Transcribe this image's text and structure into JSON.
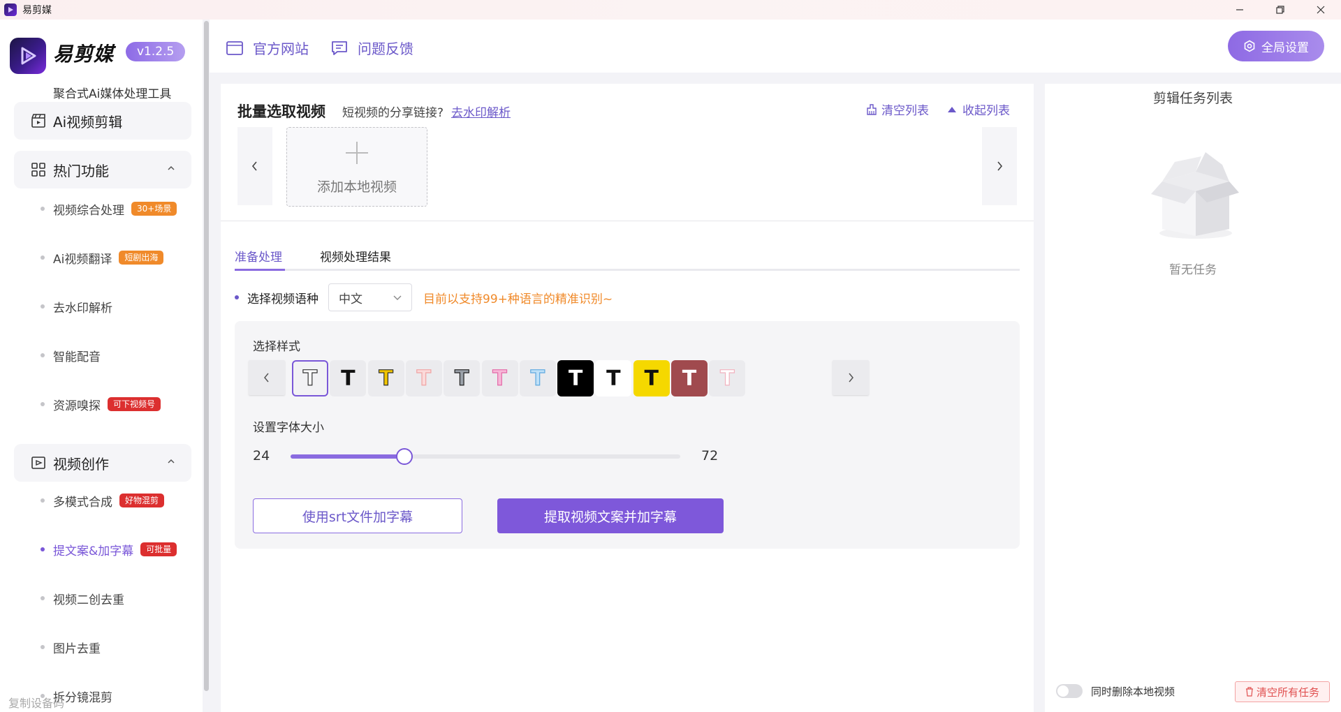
{
  "window": {
    "title": "易剪媒",
    "minimize": "—",
    "restore": "❐",
    "close": "✕"
  },
  "brand": {
    "name": "易剪媒",
    "version": "v1.2.5",
    "subtitle": "聚合式Ai媒体处理工具"
  },
  "sidebar": {
    "ai_edit": "Ai视频剪辑",
    "hot_group": "热门功能",
    "hot_items": [
      {
        "label": "视频综合处理",
        "badge": "30+场景",
        "badge_color": "#f08a2a"
      },
      {
        "label": "Ai视频翻译",
        "badge": "短剧出海",
        "badge_color": "#f08a2a"
      },
      {
        "label": "去水印解析",
        "badge": ""
      },
      {
        "label": "智能配音",
        "badge": ""
      },
      {
        "label": "资源嗅探",
        "badge": "可下视频号",
        "badge_color": "#dc2f2f"
      }
    ],
    "create_group": "视频创作",
    "create_items": [
      {
        "label": "多模式合成",
        "badge": "好物混剪",
        "badge_color": "#dc2f2f"
      },
      {
        "label": "提文案&加字幕",
        "badge": "可批量",
        "badge_color": "#dc2f2f",
        "active": true
      },
      {
        "label": "视频二创去重",
        "badge": ""
      },
      {
        "label": "图片去重",
        "badge": ""
      },
      {
        "label": "拆分镜混剪",
        "badge": ""
      }
    ],
    "copy_device": "复制设备码"
  },
  "topbar": {
    "official_site": "官方网站",
    "feedback": "问题反馈",
    "global_settings": "全局设置"
  },
  "batch": {
    "title": "批量选取视频",
    "share_prompt": "短视频的分享链接?",
    "share_link": "去水印解析",
    "clear_list": "清空列表",
    "collapse_list": "收起列表",
    "add_local": "添加本地视频"
  },
  "tabs": {
    "prepare": "准备处理",
    "results": "视频处理结果"
  },
  "language": {
    "label": "选择视频语种",
    "selected": "中文",
    "note": "目前以支持99+种语言的精准识别~"
  },
  "style": {
    "label": "选择样式",
    "chip_glyph": "T",
    "chips": [
      {
        "name": "outline-white",
        "bg": "#f2f2f4",
        "fg": "#ffffff",
        "stroke": "#333333",
        "selected": true
      },
      {
        "name": "plain-black",
        "bg": "#ebebee",
        "fg": "#111111",
        "stroke": ""
      },
      {
        "name": "yellow-outline",
        "bg": "#ebebee",
        "fg": "#f0c400",
        "stroke": "#333333"
      },
      {
        "name": "pink-light",
        "bg": "#ebebee",
        "fg": "#fbdada",
        "stroke": "#f0a4a4"
      },
      {
        "name": "gray-outline",
        "bg": "#ebebee",
        "fg": "#9aa0a8",
        "stroke": "#222222"
      },
      {
        "name": "pink",
        "bg": "#ebebee",
        "fg": "#f7b8d8",
        "stroke": "#e46aa8"
      },
      {
        "name": "light-blue",
        "bg": "#ebebee",
        "fg": "#bfe0f7",
        "stroke": "#5ea9e0"
      },
      {
        "name": "black-bg",
        "bg": "#000000",
        "fg": "#ffffff",
        "stroke": ""
      },
      {
        "name": "white-bg",
        "bg": "#ffffff",
        "fg": "#111111",
        "stroke": ""
      },
      {
        "name": "yellow-bg",
        "bg": "#f5d800",
        "fg": "#111111",
        "stroke": ""
      },
      {
        "name": "maroon-bg",
        "bg": "#a04a4e",
        "fg": "#ffffff",
        "stroke": ""
      },
      {
        "name": "pink-faint",
        "bg": "#ebebee",
        "fg": "#ffffff",
        "stroke": "#f2b3bf"
      }
    ],
    "font_size_label": "设置字体大小",
    "font_min": "24",
    "font_max": "72",
    "font_value": 38
  },
  "actions": {
    "use_srt": "使用srt文件加字幕",
    "extract": "提取视频文案并加字幕"
  },
  "tasks": {
    "title": "剪辑任务列表",
    "empty": "暂无任务",
    "delete_local": "同时删除本地视频",
    "clear_all": "清空所有任务"
  },
  "colors": {
    "accent": "#7e58da",
    "orange": "#f08a2a",
    "red": "#dc2f2f"
  }
}
